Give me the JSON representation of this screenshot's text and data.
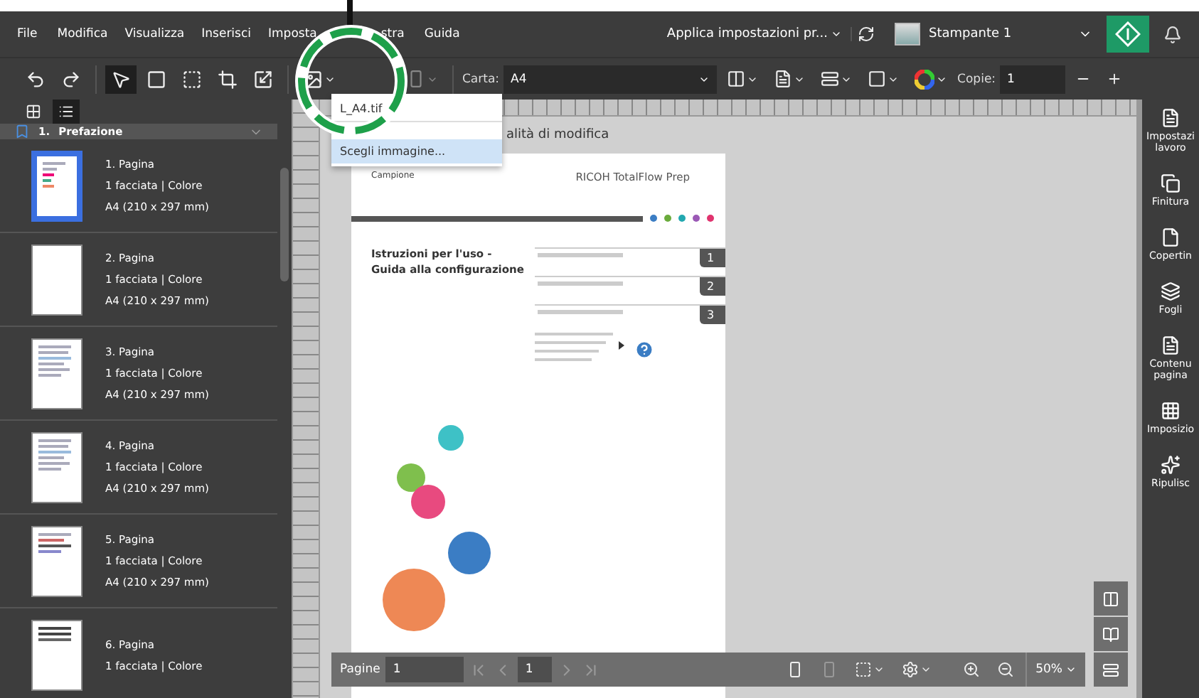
{
  "menu": [
    {
      "label": "File"
    },
    {
      "label": "Modifica"
    },
    {
      "label": "Visualizza"
    },
    {
      "label": "Inserisci"
    },
    {
      "label": "Imposta"
    },
    {
      "label": "stra"
    },
    {
      "label": "Guida"
    }
  ],
  "apply_settings": "Applica impostazioni pr...",
  "printer": "Stampante 1",
  "tools": [
    {
      "kind": "undo",
      "selected": false
    },
    {
      "kind": "redo",
      "selected": false
    },
    {
      "kind": "pointer",
      "selected": true
    },
    {
      "kind": "rect",
      "selected": false
    },
    {
      "kind": "frame",
      "selected": false
    },
    {
      "kind": "crop",
      "selected": false
    },
    {
      "kind": "resize",
      "selected": false
    },
    {
      "kind": "image",
      "selected": false
    }
  ],
  "paper_label": "Carta:",
  "paper_value": "A4",
  "copies_label": "Copie:",
  "copies_value": "1",
  "image_menu": [
    {
      "label": "L_A4.tif",
      "selected": false
    },
    {
      "label": "Scegli immagine...",
      "selected": true
    }
  ],
  "view_toggle": [
    {
      "kind": "grid",
      "selected": false
    },
    {
      "kind": "list",
      "selected": true
    }
  ],
  "section": {
    "number": "1.",
    "title": "Prefazione"
  },
  "pages": [
    {
      "title": "1. Pagina",
      "info": "1 facciata | Colore",
      "size": "A4 (210 x 297 mm)",
      "selected": true,
      "kind": "cover"
    },
    {
      "title": "2. Pagina",
      "info": "1 facciata | Colore",
      "size": "A4 (210 x 297 mm)",
      "selected": false,
      "kind": "blank"
    },
    {
      "title": "3. Pagina",
      "info": "1 facciata | Colore",
      "size": "A4 (210 x 297 mm)",
      "selected": false,
      "kind": "text"
    },
    {
      "title": "4. Pagina",
      "info": "1 facciata | Colore",
      "size": "A4 (210 x 297 mm)",
      "selected": false,
      "kind": "text"
    },
    {
      "title": "5. Pagina",
      "info": "1 facciata | Colore",
      "size": "A4 (210 x 297 mm)",
      "selected": false,
      "kind": "figure"
    },
    {
      "title": "6. Pagina",
      "info": "1 facciata | Colore",
      "selected": false,
      "kind": "screen"
    }
  ],
  "canvas_title": "alità di modifica",
  "document": {
    "label": "Campione",
    "product": "RICOH TotalFlow Prep",
    "dots": [
      {
        "color": "#3b7dc4"
      },
      {
        "color": "#6aab3c"
      },
      {
        "color": "#22a8b0"
      },
      {
        "color": "#9b59b6"
      },
      {
        "color": "#e0336e"
      }
    ],
    "title_lines": [
      "Istruzioni per l'uso -",
      "Guida alla configurazione"
    ],
    "chapters": [
      {
        "number": "1"
      },
      {
        "number": "2"
      },
      {
        "number": "3"
      }
    ]
  },
  "bottom_bar": {
    "pages_label": "Pagine",
    "pages_value": "1",
    "current_page": "1",
    "zoom": "50%"
  },
  "side_panels": [
    {
      "kind": "job",
      "label": "Impostazi lavoro"
    },
    {
      "kind": "finish",
      "label": "Finitura"
    },
    {
      "kind": "cover",
      "label": "Copertin"
    },
    {
      "kind": "sheets",
      "label": "Fogli"
    },
    {
      "kind": "content",
      "label": "Contenu pagina"
    },
    {
      "kind": "impose",
      "label": "Imposizio"
    },
    {
      "kind": "clean",
      "label": "Ripulisc"
    }
  ]
}
